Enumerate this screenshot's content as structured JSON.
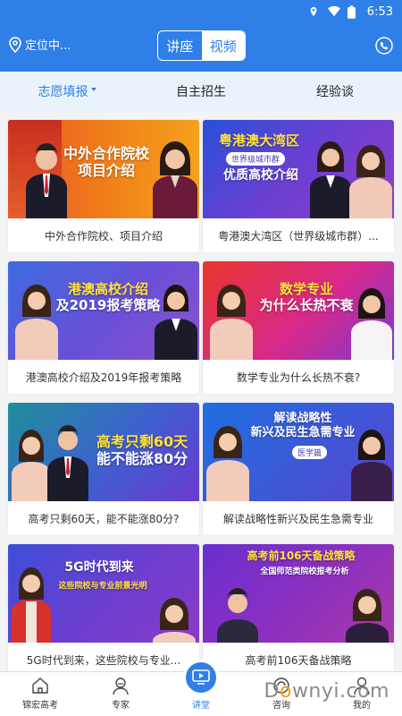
{
  "status_bar": {
    "time": "6:53"
  },
  "header": {
    "location_label": "定位中...",
    "segment": [
      "讲座",
      "视频"
    ]
  },
  "subnav": [
    "志愿填报",
    "自主招生",
    "经验谈"
  ],
  "cards": [
    {
      "caption": "中外合作院校、项目介绍",
      "thumb": [
        "中外合作院校",
        "项目介绍"
      ],
      "badge": ""
    },
    {
      "caption": "粤港澳大湾区（世界级城市群）...",
      "thumb": [
        "粤港澳大湾区",
        "优质高校介绍"
      ],
      "badge": "世界级城市群"
    },
    {
      "caption": "港澳高校介绍及2019年报考策略",
      "thumb": [
        "港澳高校介绍",
        "及2019报考策略"
      ],
      "badge": ""
    },
    {
      "caption": "数学专业为什么长热不衰?",
      "thumb": [
        "数学专业",
        "为什么长热不衰"
      ],
      "badge": ""
    },
    {
      "caption": "高考只剩60天，能不能涨80分?",
      "thumb": [
        "高考只剩60天",
        "能不能涨80分"
      ],
      "badge": ""
    },
    {
      "caption": "解读战略性新兴及民生急需专业",
      "thumb": [
        "解读战略性",
        "新兴及民生急需专业"
      ],
      "badge": "医学篇"
    },
    {
      "caption": "5G时代到来，这些院校与专业...",
      "thumb": [
        "5G时代到来",
        "这些院校与专业前景光明"
      ],
      "badge": ""
    },
    {
      "caption": "高考前106天备战策略",
      "thumb": [
        "高考前106天备战策略",
        "全国师范类院校报考分析"
      ],
      "badge": ""
    }
  ],
  "bottom_nav": [
    "锦宏高考",
    "专家",
    "讲堂",
    "咨询",
    "我的"
  ],
  "watermark": {
    "left": "D",
    "o": "o",
    "right": "wnyi.com"
  },
  "colors": {
    "primary": "#2f7fe8",
    "subnav_bg": "#eaf3fc"
  }
}
